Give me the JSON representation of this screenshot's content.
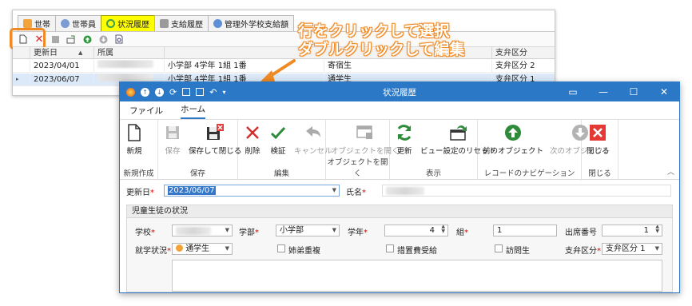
{
  "back_window": {
    "tabs": [
      {
        "label": "世帯",
        "color": "#f2a33a"
      },
      {
        "label": "世帯員",
        "color": "#7a9bd4"
      },
      {
        "label": "状況履歴",
        "color": "#3aa04a"
      },
      {
        "label": "支給履歴",
        "color": "#7a7a7a"
      },
      {
        "label": "管理外学校支給額",
        "color": "#5f8fd6"
      }
    ],
    "grid": {
      "columns": [
        "更新日",
        "所属",
        "",
        "支弁区分"
      ],
      "rows": [
        {
          "date": "2023/04/01",
          "affiliation": "小学部 4学年 1組 1番",
          "status": "寄宿生",
          "category": "支弁区分 2"
        },
        {
          "date": "2023/06/07",
          "affiliation": "小学部 4学年 1組 1番",
          "status": "通学生",
          "category": "支弁区分 1"
        }
      ]
    }
  },
  "annotation": {
    "line1": "行をクリックして選択",
    "line2": "ダブルクリックして編集"
  },
  "front_window": {
    "title": "状況履歴",
    "menu": {
      "file": "ファイル",
      "home": "ホーム"
    },
    "ribbon": {
      "groups": {
        "new": "新規作成",
        "save": "保存",
        "edit": "編集",
        "open_object": "オブジェクトを開く",
        "view": "表示",
        "record_nav": "レコードのナビゲーション",
        "close": "閉じる"
      },
      "buttons": {
        "new": "新規",
        "save": "保存",
        "save_close": "保存して閉じる",
        "delete": "削除",
        "validate": "検証",
        "cancel": "キャンセル",
        "open_object": "オブジェクトを開く",
        "refresh": "更新",
        "reset_view": "ビュー設定のリセット",
        "prev_object": "前のオブジェクト",
        "next_object": "次のオブジェクト",
        "close": "閉じる"
      }
    },
    "form": {
      "update_date_label": "更新日",
      "update_date_value": "2023/06/07",
      "name_label": "氏名",
      "section_title": "児童生徒の状況",
      "school_label": "学校",
      "department_label": "学部",
      "department_value": "小学部",
      "grade_label": "学年",
      "grade_value": "4",
      "class_label": "組",
      "class_value": "1",
      "seat_label": "出席番号",
      "seat_value": "1",
      "status_label": "就学状況",
      "status_value": "通学生",
      "sibling_label": "姉弟重複",
      "measure_label": "措置費受給",
      "visit_label": "訪問生",
      "category_label": "支弁区分",
      "category_value": "支弁区分 1",
      "required_mark": "*"
    }
  }
}
